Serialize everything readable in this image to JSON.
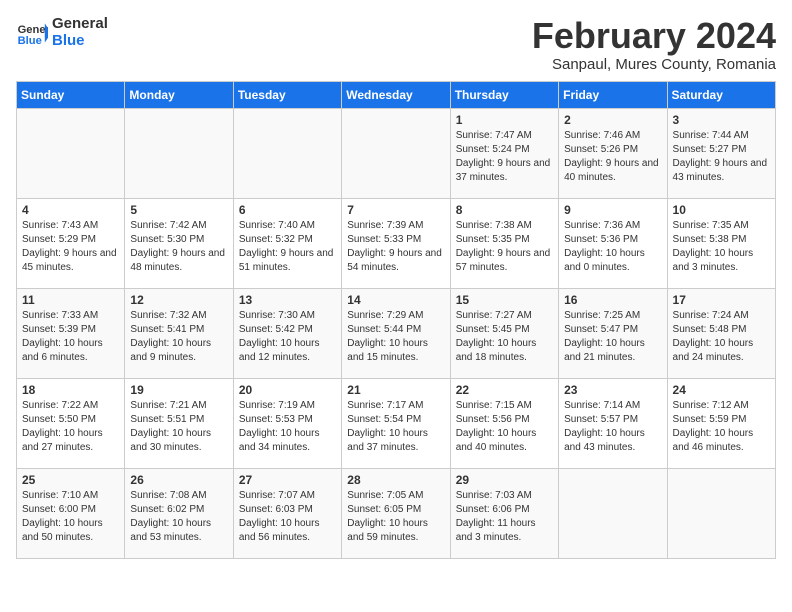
{
  "header": {
    "logo_text_general": "General",
    "logo_text_blue": "Blue",
    "month_title": "February 2024",
    "subtitle": "Sanpaul, Mures County, Romania"
  },
  "days_of_week": [
    "Sunday",
    "Monday",
    "Tuesday",
    "Wednesday",
    "Thursday",
    "Friday",
    "Saturday"
  ],
  "weeks": [
    [
      {
        "day": "",
        "info": ""
      },
      {
        "day": "",
        "info": ""
      },
      {
        "day": "",
        "info": ""
      },
      {
        "day": "",
        "info": ""
      },
      {
        "day": "1",
        "info": "Sunrise: 7:47 AM\nSunset: 5:24 PM\nDaylight: 9 hours and 37 minutes."
      },
      {
        "day": "2",
        "info": "Sunrise: 7:46 AM\nSunset: 5:26 PM\nDaylight: 9 hours and 40 minutes."
      },
      {
        "day": "3",
        "info": "Sunrise: 7:44 AM\nSunset: 5:27 PM\nDaylight: 9 hours and 43 minutes."
      }
    ],
    [
      {
        "day": "4",
        "info": "Sunrise: 7:43 AM\nSunset: 5:29 PM\nDaylight: 9 hours and 45 minutes."
      },
      {
        "day": "5",
        "info": "Sunrise: 7:42 AM\nSunset: 5:30 PM\nDaylight: 9 hours and 48 minutes."
      },
      {
        "day": "6",
        "info": "Sunrise: 7:40 AM\nSunset: 5:32 PM\nDaylight: 9 hours and 51 minutes."
      },
      {
        "day": "7",
        "info": "Sunrise: 7:39 AM\nSunset: 5:33 PM\nDaylight: 9 hours and 54 minutes."
      },
      {
        "day": "8",
        "info": "Sunrise: 7:38 AM\nSunset: 5:35 PM\nDaylight: 9 hours and 57 minutes."
      },
      {
        "day": "9",
        "info": "Sunrise: 7:36 AM\nSunset: 5:36 PM\nDaylight: 10 hours and 0 minutes."
      },
      {
        "day": "10",
        "info": "Sunrise: 7:35 AM\nSunset: 5:38 PM\nDaylight: 10 hours and 3 minutes."
      }
    ],
    [
      {
        "day": "11",
        "info": "Sunrise: 7:33 AM\nSunset: 5:39 PM\nDaylight: 10 hours and 6 minutes."
      },
      {
        "day": "12",
        "info": "Sunrise: 7:32 AM\nSunset: 5:41 PM\nDaylight: 10 hours and 9 minutes."
      },
      {
        "day": "13",
        "info": "Sunrise: 7:30 AM\nSunset: 5:42 PM\nDaylight: 10 hours and 12 minutes."
      },
      {
        "day": "14",
        "info": "Sunrise: 7:29 AM\nSunset: 5:44 PM\nDaylight: 10 hours and 15 minutes."
      },
      {
        "day": "15",
        "info": "Sunrise: 7:27 AM\nSunset: 5:45 PM\nDaylight: 10 hours and 18 minutes."
      },
      {
        "day": "16",
        "info": "Sunrise: 7:25 AM\nSunset: 5:47 PM\nDaylight: 10 hours and 21 minutes."
      },
      {
        "day": "17",
        "info": "Sunrise: 7:24 AM\nSunset: 5:48 PM\nDaylight: 10 hours and 24 minutes."
      }
    ],
    [
      {
        "day": "18",
        "info": "Sunrise: 7:22 AM\nSunset: 5:50 PM\nDaylight: 10 hours and 27 minutes."
      },
      {
        "day": "19",
        "info": "Sunrise: 7:21 AM\nSunset: 5:51 PM\nDaylight: 10 hours and 30 minutes."
      },
      {
        "day": "20",
        "info": "Sunrise: 7:19 AM\nSunset: 5:53 PM\nDaylight: 10 hours and 34 minutes."
      },
      {
        "day": "21",
        "info": "Sunrise: 7:17 AM\nSunset: 5:54 PM\nDaylight: 10 hours and 37 minutes."
      },
      {
        "day": "22",
        "info": "Sunrise: 7:15 AM\nSunset: 5:56 PM\nDaylight: 10 hours and 40 minutes."
      },
      {
        "day": "23",
        "info": "Sunrise: 7:14 AM\nSunset: 5:57 PM\nDaylight: 10 hours and 43 minutes."
      },
      {
        "day": "24",
        "info": "Sunrise: 7:12 AM\nSunset: 5:59 PM\nDaylight: 10 hours and 46 minutes."
      }
    ],
    [
      {
        "day": "25",
        "info": "Sunrise: 7:10 AM\nSunset: 6:00 PM\nDaylight: 10 hours and 50 minutes."
      },
      {
        "day": "26",
        "info": "Sunrise: 7:08 AM\nSunset: 6:02 PM\nDaylight: 10 hours and 53 minutes."
      },
      {
        "day": "27",
        "info": "Sunrise: 7:07 AM\nSunset: 6:03 PM\nDaylight: 10 hours and 56 minutes."
      },
      {
        "day": "28",
        "info": "Sunrise: 7:05 AM\nSunset: 6:05 PM\nDaylight: 10 hours and 59 minutes."
      },
      {
        "day": "29",
        "info": "Sunrise: 7:03 AM\nSunset: 6:06 PM\nDaylight: 11 hours and 3 minutes."
      },
      {
        "day": "",
        "info": ""
      },
      {
        "day": "",
        "info": ""
      }
    ]
  ]
}
